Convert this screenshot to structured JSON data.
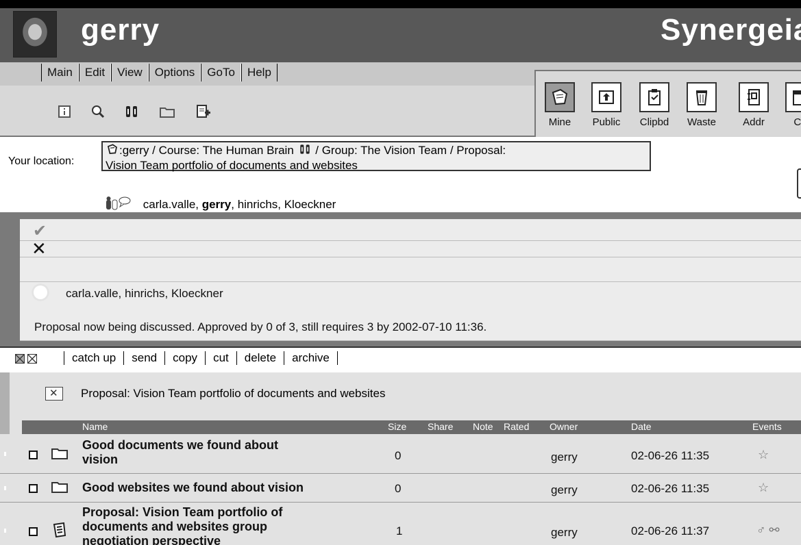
{
  "header": {
    "username": "gerry",
    "app_title": "Synergeia"
  },
  "menu": [
    "Main",
    "Edit",
    "View",
    "Options",
    "GoTo",
    "Help"
  ],
  "tabs": [
    {
      "label": "Mine",
      "icon": "mine-icon"
    },
    {
      "label": "Public",
      "icon": "public-icon"
    },
    {
      "label": "Clipbd",
      "icon": "clipboard-icon"
    },
    {
      "label": "Waste",
      "icon": "wastebasket-icon"
    },
    {
      "label": "Addr",
      "icon": "address-book-icon"
    },
    {
      "label": "Ca",
      "icon": "calendar-icon"
    }
  ],
  "location": {
    "label": "Your location:",
    "path_line1": ":gerry / Course: The Human Brain",
    "path_line1b": "/ Group: The Vision Team / Proposal:",
    "path_line2": "Vision Team portfolio of documents and websites",
    "members_prefix": "carla.valle, ",
    "members_bold": "gerry",
    "members_suffix": ", hinrichs, Kloeckner"
  },
  "proposal": {
    "pending_users": "carla.valle, hinrichs, Kloeckner",
    "status": "Proposal now being discussed. Approved by 0 of 3, still requires 3 by 2002-07-10 11:36."
  },
  "actions": [
    "catch up",
    "send",
    "copy",
    "cut",
    "delete",
    "archive"
  ],
  "folder": {
    "title": "Proposal: Vision Team portfolio of documents and websites",
    "columns": {
      "name": "Name",
      "size": "Size",
      "share": "Share",
      "note": "Note",
      "rated": "Rated",
      "owner": "Owner",
      "date": "Date",
      "events": "Events"
    },
    "rows": [
      {
        "name_line1": "Good documents we found about",
        "name_line2": "vision",
        "size": "0",
        "owner": "gerry",
        "date": "02-06-26 11:35",
        "icon": "folder-icon",
        "events": "☆"
      },
      {
        "name_line1": "Good websites we found about vision",
        "size": "0",
        "owner": "gerry",
        "date": "02-06-26 11:35",
        "icon": "folder-icon",
        "events": "☆"
      },
      {
        "name_line1": "Proposal: Vision Team portfolio of",
        "name_line2": "documents and websites group",
        "name_line3": "negotiation perspective",
        "size": "1",
        "owner": "gerry",
        "date": "02-06-26 11:37",
        "icon": "proposal-icon",
        "events": "♂ ⚯"
      }
    ]
  }
}
